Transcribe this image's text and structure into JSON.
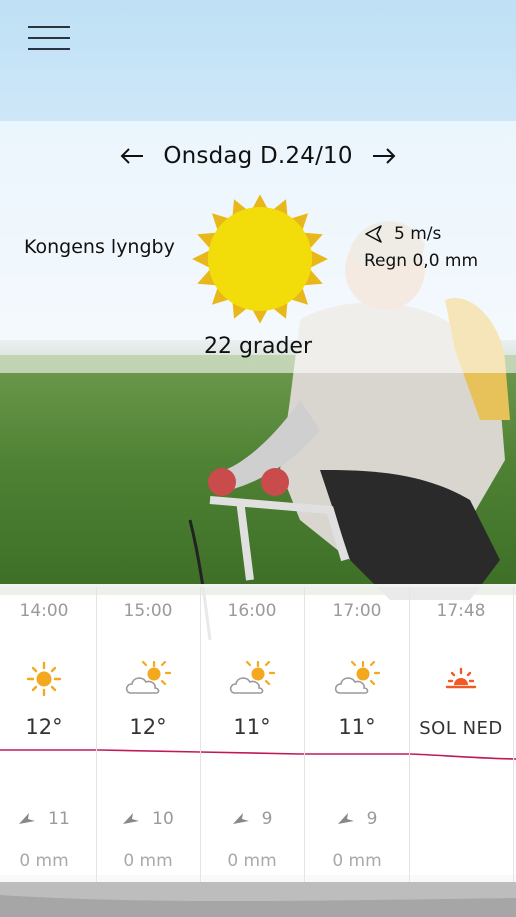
{
  "app": {
    "menu_icon": "hamburger-menu-icon"
  },
  "header": {
    "date": "Onsdag D.24/10",
    "prev_icon": "arrow-left-icon",
    "next_icon": "arrow-right-icon"
  },
  "current": {
    "location": "Kongens lyngby",
    "weather_icon": "sun-icon",
    "wind": "5 m/s",
    "wind_icon": "wind-direction-icon",
    "rain": "Regn 0,0 mm",
    "temperature": "22 grader"
  },
  "forecast": [
    {
      "time": "14:00",
      "icon": "sun-icon",
      "temp": "12°",
      "wind": "11",
      "rain": "0 mm"
    },
    {
      "time": "15:00",
      "icon": "partly-cloudy-icon",
      "temp": "12°",
      "wind": "10",
      "rain": "0 mm"
    },
    {
      "time": "16:00",
      "icon": "partly-cloudy-icon",
      "temp": "11°",
      "wind": "9",
      "rain": "0 mm"
    },
    {
      "time": "17:00",
      "icon": "partly-cloudy-icon",
      "temp": "11°",
      "wind": "9",
      "rain": "0 mm"
    },
    {
      "time": "17:48",
      "icon": "sunset-icon",
      "temp": "SOL NED",
      "wind": "",
      "rain": ""
    }
  ],
  "colors": {
    "sun_fill": "#f2dd0a",
    "sun_rays": "#e8b81a",
    "forecast_sun": "#f4a81d",
    "sunset": "#f15a24",
    "temp_line": "#c2185b"
  }
}
